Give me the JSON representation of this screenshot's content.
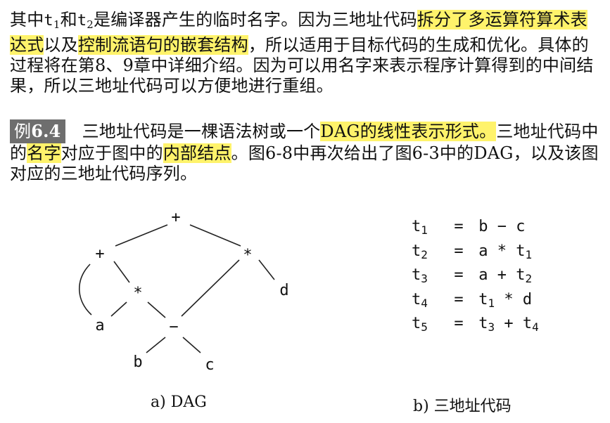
{
  "paragraph1": {
    "part1": "其中",
    "t1_base": "t",
    "t1_sub": "1",
    "part2": "和",
    "t2_base": "t",
    "t2_sub": "2",
    "part3": "是编译器产生的临时名字。因为三地址代码",
    "hl1": "拆分了多运算符算术表达式",
    "part4": "以及",
    "hl2": "控制流语句的嵌套结构",
    "part5": "，所以适用于目标代码的生成和优化。具体的过程将在第8、9章中详细介绍。因为可以用名字来表示程序计算得到的中间结果，所以三地址代码可以方便地进行重组。"
  },
  "paragraph2": {
    "badge_prefix": "例",
    "badge_number": "6.4",
    "part1": "三地址代码是一棵语法树或一个",
    "hl1": "DAG的线性表示形式。",
    "part2": "三地址代码中的",
    "hl2": "名字",
    "part3": "对应于图中的",
    "hl3": "内部结点",
    "part4": "。图6-8中再次给出了图6-3中的DAG，以及该图对应的三地址代码序列。"
  },
  "dag": {
    "nodes": {
      "plus_root": "+",
      "plus_left": "+",
      "star_right": "*",
      "star_mid": "*",
      "d": "d",
      "a": "a",
      "minus": "−",
      "b": "b",
      "c": "c"
    }
  },
  "three_address_code": [
    {
      "lhs": "t",
      "lhs_sub": "1",
      "eq": "=",
      "rhs_a": "b",
      "op": "−",
      "rhs_b": "c",
      "rhs_b_sub": ""
    },
    {
      "lhs": "t",
      "lhs_sub": "2",
      "eq": "=",
      "rhs_a": "a",
      "op": "*",
      "rhs_b": "t",
      "rhs_b_sub": "1"
    },
    {
      "lhs": "t",
      "lhs_sub": "3",
      "eq": "=",
      "rhs_a": "a",
      "op": "+",
      "rhs_b": "t",
      "rhs_b_sub": "2"
    },
    {
      "lhs": "t",
      "lhs_sub": "4",
      "eq": "=",
      "rhs_a": "t",
      "rhs_a_sub": "1",
      "op": "*",
      "rhs_b": "d",
      "rhs_b_sub": ""
    },
    {
      "lhs": "t",
      "lhs_sub": "5",
      "eq": "=",
      "rhs_a": "t",
      "rhs_a_sub": "3",
      "op": "+",
      "rhs_b": "t",
      "rhs_b_sub": "4"
    }
  ],
  "captions": {
    "a": "a)  DAG",
    "b": "b)  三地址代码"
  }
}
